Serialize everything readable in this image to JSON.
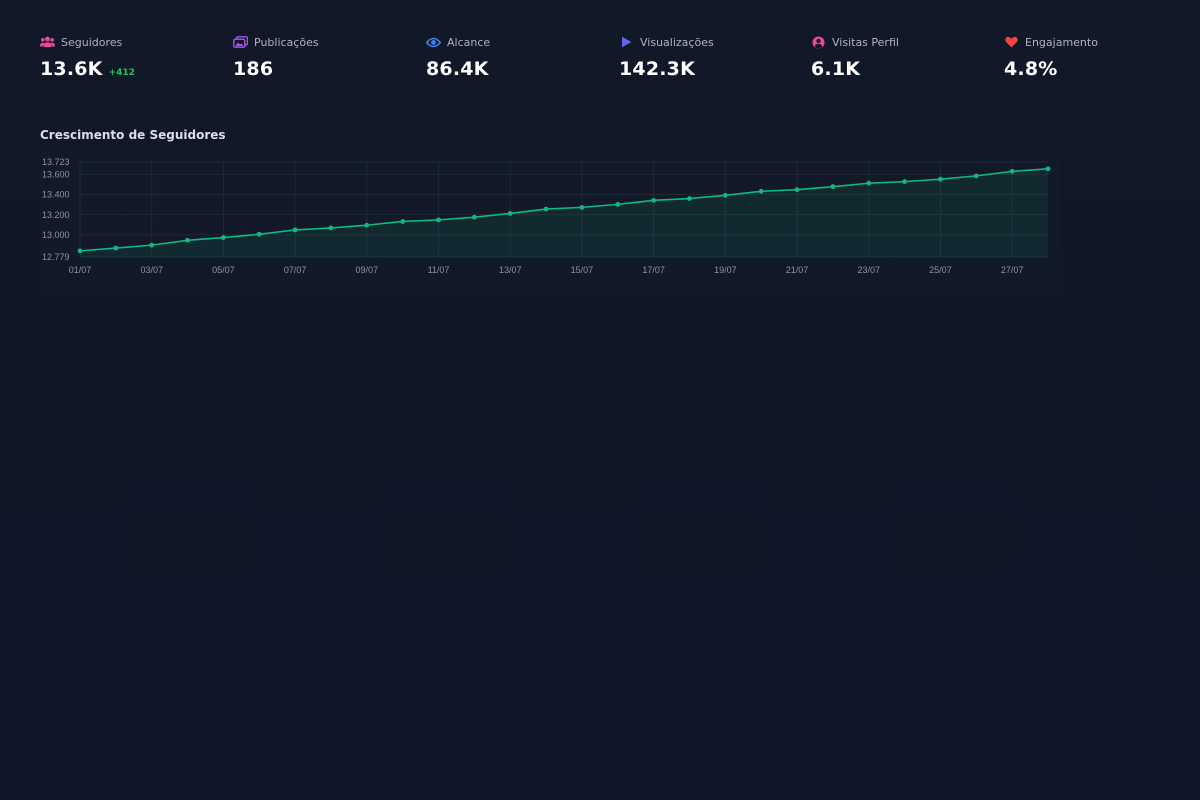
{
  "metrics": [
    {
      "label": "Seguidores",
      "value": "13.6K",
      "delta": "+412",
      "icon": "users-icon",
      "color": "#ec4899"
    },
    {
      "label": "Publicações",
      "value": "186",
      "delta": "",
      "icon": "images-icon",
      "color": "#a855f7"
    },
    {
      "label": "Alcance",
      "value": "86.4K",
      "delta": "",
      "icon": "eye-icon",
      "color": "#3b82f6"
    },
    {
      "label": "Visualizações",
      "value": "142.3K",
      "delta": "",
      "icon": "play-icon",
      "color": "#6366f1"
    },
    {
      "label": "Visitas Perfil",
      "value": "6.1K",
      "delta": "",
      "icon": "user-circle-icon",
      "color": "#ec4899"
    },
    {
      "label": "Engajamento",
      "value": "4.8%",
      "delta": "",
      "icon": "heart-icon",
      "color": "#ef4444"
    }
  ],
  "chart_section": {
    "title": "Crescimento de Seguidores"
  },
  "chart_data": {
    "type": "area",
    "title": "Crescimento de Seguidores",
    "xlabel": "",
    "ylabel": "",
    "x": [
      "01/07",
      "02/07",
      "03/07",
      "04/07",
      "05/07",
      "06/07",
      "07/07",
      "08/07",
      "09/07",
      "10/07",
      "11/07",
      "12/07",
      "13/07",
      "14/07",
      "15/07",
      "16/07",
      "17/07",
      "18/07",
      "19/07",
      "20/07",
      "21/07",
      "22/07",
      "23/07",
      "24/07",
      "25/07",
      "26/07",
      "27/07",
      "28/07"
    ],
    "series": [
      {
        "name": "",
        "values": [
          12840,
          12868,
          12897,
          12945,
          12972,
          13005,
          13048,
          13068,
          13095,
          13132,
          13148,
          13175,
          13212,
          13255,
          13272,
          13302,
          13342,
          13360,
          13392,
          13432,
          13448,
          13478,
          13512,
          13528,
          13552,
          13585,
          13630,
          13655
        ]
      }
    ],
    "ylim": [
      12779,
      13723
    ],
    "y_ticks": [
      "12.779",
      "13.000",
      "13.200",
      "13.400",
      "13.600",
      "13.723"
    ],
    "y_tick_values": [
      12779,
      13000,
      13200,
      13400,
      13600,
      13723
    ],
    "x_tick_labels": [
      "01/07",
      "03/07",
      "05/07",
      "07/07",
      "09/07",
      "11/07",
      "13/07",
      "15/07",
      "17/07",
      "19/07",
      "21/07",
      "23/07",
      "25/07",
      "27/07"
    ],
    "grid": true,
    "line_color": "#10b981",
    "fill_color": "#10b981"
  }
}
